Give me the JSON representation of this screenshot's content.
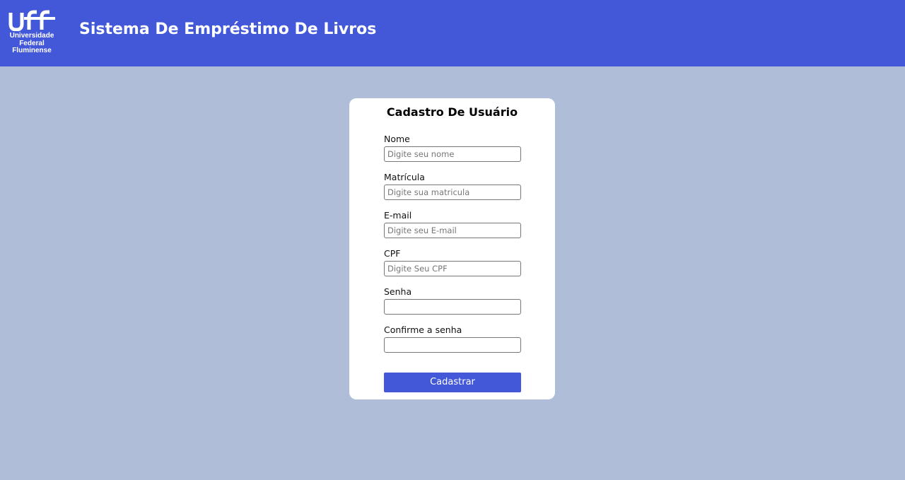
{
  "header": {
    "logo": {
      "icon": "uff-logo-icon",
      "lines": [
        "Universidade",
        "Federal",
        "Fluminense"
      ]
    },
    "title": "Sistema De Empréstimo De Livros"
  },
  "form": {
    "title": "Cadastro De Usuário",
    "fields": [
      {
        "label": "Nome",
        "placeholder": "Digite seu nome",
        "value": ""
      },
      {
        "label": "Matrícula",
        "placeholder": "Digite sua matricula",
        "value": ""
      },
      {
        "label": "E-mail",
        "placeholder": "Digite seu E-mail",
        "value": ""
      },
      {
        "label": "CPF",
        "placeholder": "Digite Seu CPF",
        "value": ""
      },
      {
        "label": "Senha",
        "placeholder": "",
        "value": ""
      },
      {
        "label": "Confirme a senha",
        "placeholder": "",
        "value": ""
      }
    ],
    "submit_label": "Cadastrar"
  },
  "colors": {
    "header_bg": "#4358d9",
    "page_bg": "#b0bdd8",
    "card_bg": "#ffffff",
    "button_bg": "#4358d9"
  }
}
